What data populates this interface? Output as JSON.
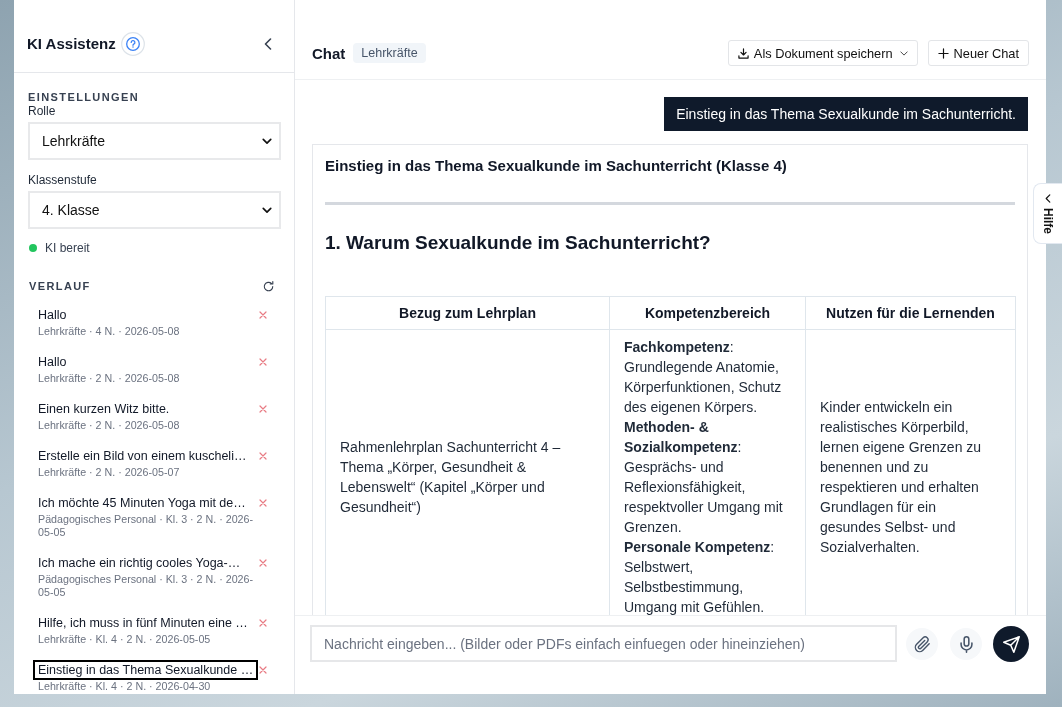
{
  "sidebar": {
    "title": "KI Assistenz",
    "settings": {
      "heading": "EINSTELLUNGEN",
      "fields": [
        {
          "label": "Rolle",
          "value": "Lehrkräfte"
        },
        {
          "label": "Klassenstufe",
          "value": "4. Klasse"
        }
      ]
    },
    "status": {
      "label": "KI bereit",
      "ready": true
    },
    "history": {
      "heading": "VERLAUF",
      "items": [
        {
          "title": "Hallo",
          "meta": "Lehrkräfte · 4 N. · 2026-05-08",
          "selected": false
        },
        {
          "title": "Hallo",
          "meta": "Lehrkräfte · 2 N. · 2026-05-08",
          "selected": false
        },
        {
          "title": "Einen kurzen Witz bitte.",
          "meta": "Lehrkräfte · 2 N. · 2026-05-08",
          "selected": false
        },
        {
          "title": "Erstelle ein Bild von einem kuscheli…",
          "meta": "Lehrkräfte · 2 N. · 2026-05-07",
          "selected": false
        },
        {
          "title": "Ich möchte 45 Minuten Yoga mit de…",
          "meta": "Pädagogisches Personal · Kl. 3 · 2 N. · 2026-05-05",
          "selected": false
        },
        {
          "title": "Ich mache ein richtig cooles Yoga-…",
          "meta": "Pädagogisches Personal · Kl. 3 · 2 N. · 2026-05-05",
          "selected": false
        },
        {
          "title": "Hilfe, ich muss in fünf Minuten eine …",
          "meta": "Lehrkräfte · Kl. 4 · 2 N. · 2026-05-05",
          "selected": false
        },
        {
          "title": "Einstieg in das Thema Sexualkunde …",
          "meta": "Lehrkräfte · Kl. 4 · 2 N. · 2026-04-30",
          "selected": true
        }
      ]
    }
  },
  "chat": {
    "title": "Chat",
    "role_badge": "Lehrkräfte",
    "actions": [
      {
        "label": "Als Dokument speichern",
        "kind": "export"
      },
      {
        "label": "Neuer Chat",
        "kind": "new"
      }
    ],
    "messages": [
      {
        "kind": "user",
        "text": "Einstieg in das Thema Sexualkunde im Sachunterricht."
      },
      {
        "kind": "assistant",
        "title": "Einstieg in das Thema Sexualkunde im Sachunterricht (Klasse 4)",
        "heading": "1. Warum Sexualkunde im Sachunterricht?",
        "table": {
          "columns": [
            "Bezug zum Lehrplan",
            "Kompetenzbereich",
            "Nutzen für die Lernenden"
          ],
          "rows": [
            [
              [
                "Rahmenlehrplan Sachunterricht 4 –",
                "Thema „Körper, Gesundheit & Lebenswelt“ (Kapitel „Körper und Gesundheit“)"
              ],
              [
                "**Fachkompetenz**: Grundlegende Anatomie, Körperfunktionen, Schutz des eigenen Körpers.",
                "**Methoden- & Sozialkompetenz**: Gesprächs- und Reflexionsfähigkeit, respektvoller Umgang mit Grenzen.",
                "**Personale Kompetenz**: Selbstwert, Selbstbestimmung, Umgang mit Gefühlen."
              ],
              [
                "Kinder entwickeln ein realistisches Körperbild, lernen eigene Grenzen zu benennen und zu respektieren und erhalten Grundlagen für ein gesundes Selbst- und Sozialverhalten."
              ]
            ]
          ]
        }
      }
    ],
    "composer": {
      "placeholder": "Nachricht eingeben... (Bilder oder PDFs einfach einfuegen oder hineinziehen)"
    }
  },
  "help_tab": {
    "label": "Hilfe"
  }
}
